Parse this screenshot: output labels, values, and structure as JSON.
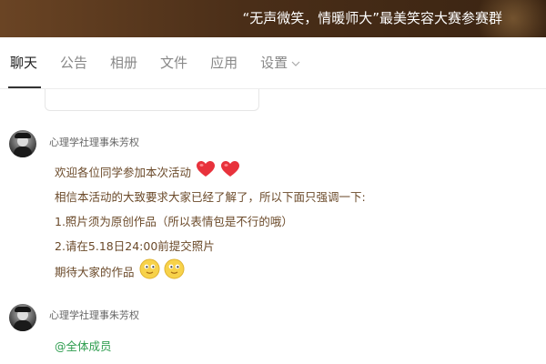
{
  "header": {
    "title": "“无声微笑，情暖师大”最美笑容大赛参赛群"
  },
  "tabs": [
    {
      "label": "聊天",
      "active": true
    },
    {
      "label": "公告"
    },
    {
      "label": "相册"
    },
    {
      "label": "文件"
    },
    {
      "label": "应用"
    },
    {
      "label": "设置"
    }
  ],
  "messages": [
    {
      "sender": "心理学社理事朱芳权",
      "lines": [
        "欢迎各位同学参加本次活动",
        "相信本活动的大致要求大家已经了解了，所以下面只强调一下:",
        "1.照片须为原创作品（所以表情包是不行的哦）",
        "2.请在5.18日24:00前提交照片",
        "期待大家的作品"
      ],
      "icons": [
        "heart-icon",
        "heart-icon",
        "smiley-icon",
        "smiley-icon"
      ]
    },
    {
      "sender": "心理学社理事朱芳权",
      "mention": "@全体成员"
    }
  ],
  "colors": {
    "header_bg": "#5a3a1f",
    "message_text": "#6b4a2a",
    "mention": "#2e9d4f",
    "heart": "#e8323c",
    "smiley": "#f7d24a"
  }
}
